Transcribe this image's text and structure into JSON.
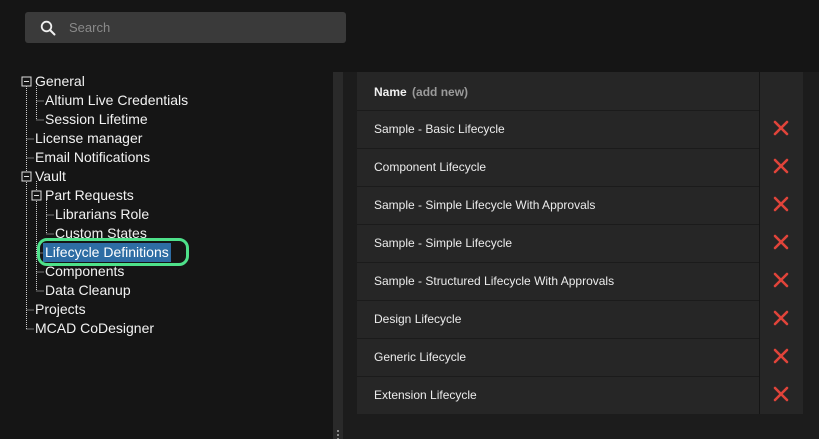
{
  "search": {
    "placeholder": "Search",
    "icon": "search-icon"
  },
  "tree": {
    "general": "General",
    "altium_live_credentials": "Altium Live Credentials",
    "session_lifetime": "Session Lifetime",
    "license_manager": "License manager",
    "email_notifications": "Email Notifications",
    "vault": "Vault",
    "part_requests": "Part Requests",
    "librarians_role": "Librarians Role",
    "custom_states": "Custom States",
    "lifecycle_definitions": "Lifecycle Definitions",
    "components": "Components",
    "data_cleanup": "Data Cleanup",
    "projects": "Projects",
    "mcad_codesigner": "MCAD CoDesigner"
  },
  "table": {
    "header_name": "Name",
    "header_add_new": "(add new)",
    "rows": [
      "Sample - Basic Lifecycle",
      "Component Lifecycle",
      "Sample - Simple Lifecycle With Approvals",
      "Sample - Simple Lifecycle",
      "Sample - Structured Lifecycle With Approvals",
      "Design Lifecycle",
      "Generic Lifecycle",
      "Extension Lifecycle"
    ],
    "delete_icon": "close-icon",
    "delete_color": "#e0443a"
  },
  "colors": {
    "background": "#151515",
    "selection": "#2e6da4",
    "highlight_ring": "#4ee18a"
  }
}
